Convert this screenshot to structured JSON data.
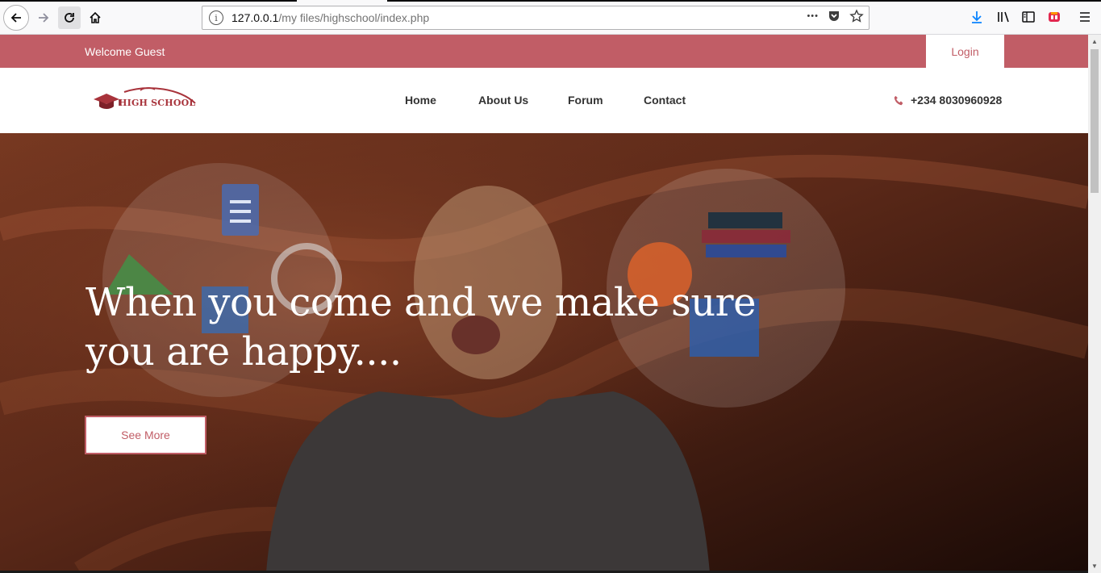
{
  "browser": {
    "url_host": "127.0.0.1",
    "url_path": "/my files/highschool/index.php",
    "more_glyph": "•••"
  },
  "topbar": {
    "welcome": "Welcome Guest",
    "login": "Login"
  },
  "header": {
    "logo_text": "HIGH SCHOOL",
    "nav": [
      "Home",
      "About Us",
      "Forum",
      "Contact"
    ],
    "phone": "+234 8030960928"
  },
  "hero": {
    "title_line1": "When you come and we make sure",
    "title_line2": "you are happy....",
    "cta": "See More"
  },
  "colors": {
    "brand": "#c15d66",
    "hero_bg": "#3a1a10"
  }
}
